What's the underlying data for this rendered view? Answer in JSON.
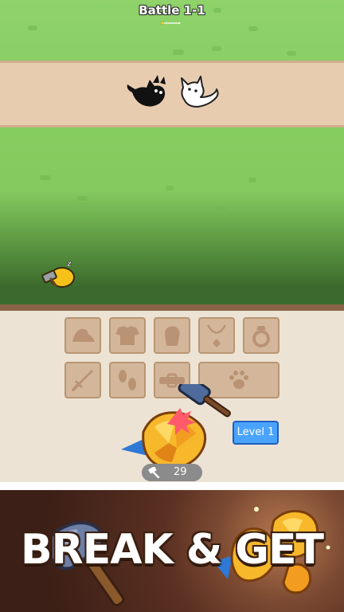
{
  "battle": {
    "title": "Battle 1-1",
    "progress": 0.05
  },
  "enemies": [
    {
      "name": "black-cat"
    },
    {
      "name": "white-cat"
    }
  ],
  "idle_hero": {
    "status": "z"
  },
  "equipment_slots": [
    {
      "name": "hat",
      "icon": "hat-icon"
    },
    {
      "name": "shirt",
      "icon": "shirt-icon"
    },
    {
      "name": "gloves",
      "icon": "glove-icon"
    },
    {
      "name": "necklace",
      "icon": "necklace-icon"
    },
    {
      "name": "ring",
      "icon": "ring-icon"
    },
    {
      "name": "weapon",
      "icon": "sword-icon"
    },
    {
      "name": "boots",
      "icon": "footprints-icon"
    },
    {
      "name": "belt",
      "icon": "belt-icon"
    },
    {
      "name": "pet",
      "icon": "paw-icon"
    }
  ],
  "anvil": {
    "level_label": "Level 1",
    "hammer_count": "29"
  },
  "banner": {
    "text": "BREAK & GET"
  },
  "colors": {
    "grass": "#8ad066",
    "path": "#e8ccb0",
    "panel": "#ede3d4",
    "slot": "#d4b79a",
    "level_badge": "#4aa3ff"
  }
}
